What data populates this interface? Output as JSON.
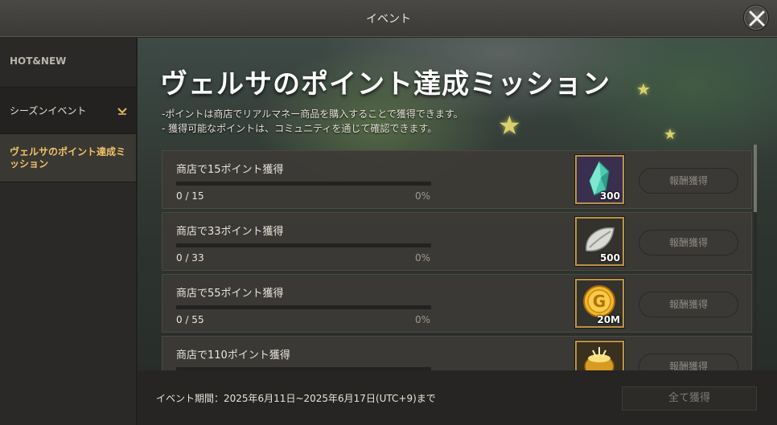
{
  "window": {
    "title": "イベント"
  },
  "sidebar": {
    "header": "HOT&NEW",
    "items": [
      {
        "label": "シーズンイベント",
        "expandable": true
      },
      {
        "label": "ヴェルサのポイント達成ミッション",
        "active": true
      }
    ]
  },
  "event": {
    "title": "ヴェルサのポイント達成ミッション",
    "descriptions": [
      "-ポイントは商店でリアルマネー商品を購入することで獲得できます。",
      "- 獲得可能なポイントは、コミュニティを通じて確認できます。"
    ]
  },
  "missions": [
    {
      "title": "商店で15ポイント獲得",
      "count": "0 / 15",
      "percent": "0%",
      "progress": 0,
      "reward_icon": "crystal-icon",
      "reward_qty": "300",
      "claim_label": "報酬獲得"
    },
    {
      "title": "商店で33ポイント獲得",
      "count": "0 / 33",
      "percent": "0%",
      "progress": 0,
      "reward_icon": "silver-leaf-icon",
      "reward_qty": "500",
      "claim_label": "報酬獲得"
    },
    {
      "title": "商店で55ポイント獲得",
      "count": "0 / 55",
      "percent": "0%",
      "progress": 0,
      "reward_icon": "gold-coin-icon",
      "reward_qty": "20M",
      "claim_label": "報酬獲得"
    },
    {
      "title": "商店で110ポイント獲得",
      "count": "",
      "percent": "",
      "progress": 0,
      "reward_icon": "treasure-pot-icon",
      "reward_qty": "",
      "claim_label": "報酬獲得"
    }
  ],
  "footer": {
    "period": "イベント期間：2025年6月11日~2025年6月17日(UTC+9)まで",
    "claim_all_label": "全て獲得"
  },
  "colors": {
    "accent": "#f0c26a",
    "reward_border": "#b99448"
  }
}
